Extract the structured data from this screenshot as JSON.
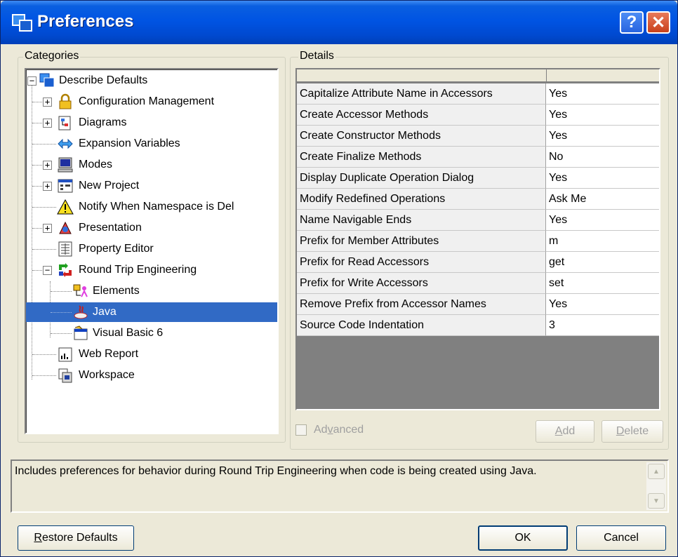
{
  "window": {
    "title": "Preferences",
    "help_glyph": "?",
    "close_glyph": "✕"
  },
  "categories": {
    "legend": "Categories",
    "items": [
      {
        "label": "Describe Defaults",
        "icon": "describe-defaults-icon"
      },
      {
        "label": "Configuration Management",
        "icon": "lock-icon"
      },
      {
        "label": "Diagrams",
        "icon": "diagrams-icon"
      },
      {
        "label": "Expansion Variables",
        "icon": "expansion-variables-icon"
      },
      {
        "label": "Modes",
        "icon": "computer-icon"
      },
      {
        "label": "New Project",
        "icon": "new-project-icon"
      },
      {
        "label": "Notify When Namespace is Del",
        "icon": "warning-icon"
      },
      {
        "label": "Presentation",
        "icon": "presentation-icon"
      },
      {
        "label": "Property Editor",
        "icon": "property-editor-icon"
      },
      {
        "label": "Round Trip Engineering",
        "icon": "round-trip-icon"
      },
      {
        "label": "Elements",
        "icon": "elements-icon"
      },
      {
        "label": "Java",
        "icon": "java-icon"
      },
      {
        "label": "Visual Basic 6",
        "icon": "visual-basic-icon"
      },
      {
        "label": "Web Report",
        "icon": "web-report-icon"
      },
      {
        "label": "Workspace",
        "icon": "workspace-icon"
      }
    ],
    "selected": "Java"
  },
  "details": {
    "legend": "Details",
    "rows": [
      {
        "name": "Capitalize Attribute Name in Accessors",
        "value": "Yes"
      },
      {
        "name": "Create Accessor Methods",
        "value": "Yes"
      },
      {
        "name": "Create Constructor Methods",
        "value": "Yes"
      },
      {
        "name": "Create Finalize Methods",
        "value": "No"
      },
      {
        "name": "Display Duplicate Operation Dialog",
        "value": "Yes"
      },
      {
        "name": "Modify Redefined Operations",
        "value": "Ask Me"
      },
      {
        "name": "Name Navigable Ends",
        "value": "Yes"
      },
      {
        "name": "Prefix for Member Attributes",
        "value": "m"
      },
      {
        "name": "Prefix for Read Accessors",
        "value": "get"
      },
      {
        "name": "Prefix for Write Accessors",
        "value": "set"
      },
      {
        "name": "Remove Prefix from Accessor Names",
        "value": "Yes"
      },
      {
        "name": "Source Code Indentation",
        "value": "3"
      }
    ],
    "advanced_label_pre": "Ad",
    "advanced_label_u": "v",
    "advanced_label_post": "anced",
    "add_label_u": "A",
    "add_label_post": "dd",
    "delete_label_u": "D",
    "delete_label_post": "elete"
  },
  "description": "Includes preferences for behavior during Round Trip Engineering when code is being created using Java.",
  "footer": {
    "restore_u": "R",
    "restore_post": "estore Defaults",
    "ok_label": "OK",
    "cancel_label": "Cancel"
  },
  "colors": {
    "selection": "#316ac5",
    "titlebar": "#0054e3",
    "dialog_bg": "#ece9d8"
  }
}
